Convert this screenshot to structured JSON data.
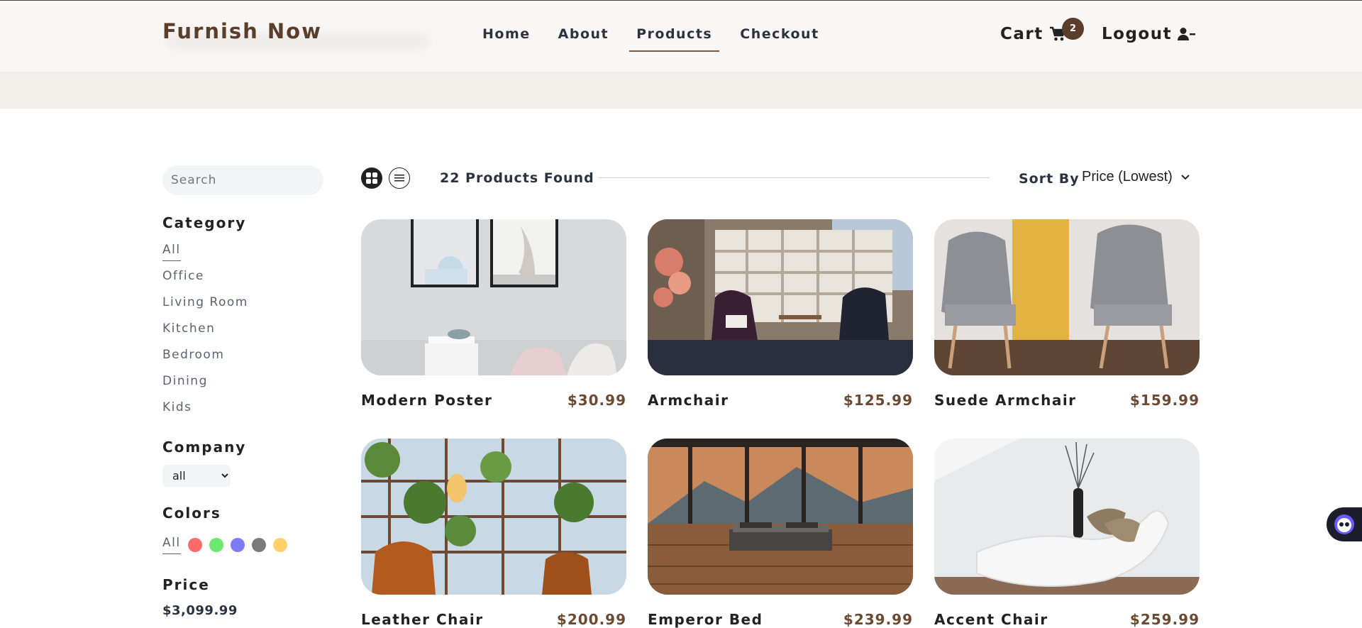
{
  "header": {
    "brand": "Furnish Now",
    "nav": [
      {
        "label": "Home"
      },
      {
        "label": "About"
      },
      {
        "label": "Products"
      },
      {
        "label": "Checkout"
      }
    ],
    "cart_label": "Cart",
    "cart_count": "2",
    "logout_label": "Logout"
  },
  "filters": {
    "search_placeholder": "Search",
    "category_title": "Category",
    "categories": [
      "All",
      "Office",
      "Living Room",
      "Kitchen",
      "Bedroom",
      "Dining",
      "Kids"
    ],
    "company_title": "Company",
    "company_selected": "all",
    "colors_title": "Colors",
    "colors_all": "All",
    "swatches": [
      "#ff6b6b",
      "#6ee76e",
      "#7b7bf5",
      "#7a7a7a",
      "#ffd166"
    ],
    "price_title": "Price",
    "price_value": "$3,099.99"
  },
  "toolbar": {
    "found": "22 Products Found",
    "sort_label": "Sort By",
    "sort_selected": "Price (Lowest)"
  },
  "products": [
    {
      "name": "Modern Poster",
      "price": "$30.99"
    },
    {
      "name": "Armchair",
      "price": "$125.99"
    },
    {
      "name": "Suede Armchair",
      "price": "$159.99"
    },
    {
      "name": "Leather Chair",
      "price": "$200.99"
    },
    {
      "name": "Emperor Bed",
      "price": "$239.99"
    },
    {
      "name": "Accent Chair",
      "price": "$259.99"
    }
  ],
  "colors": {
    "brand": "#5a3e2b",
    "price": "#6a4a33",
    "header_bg": "#f8f7f5",
    "band_bg": "#f1ede9"
  }
}
